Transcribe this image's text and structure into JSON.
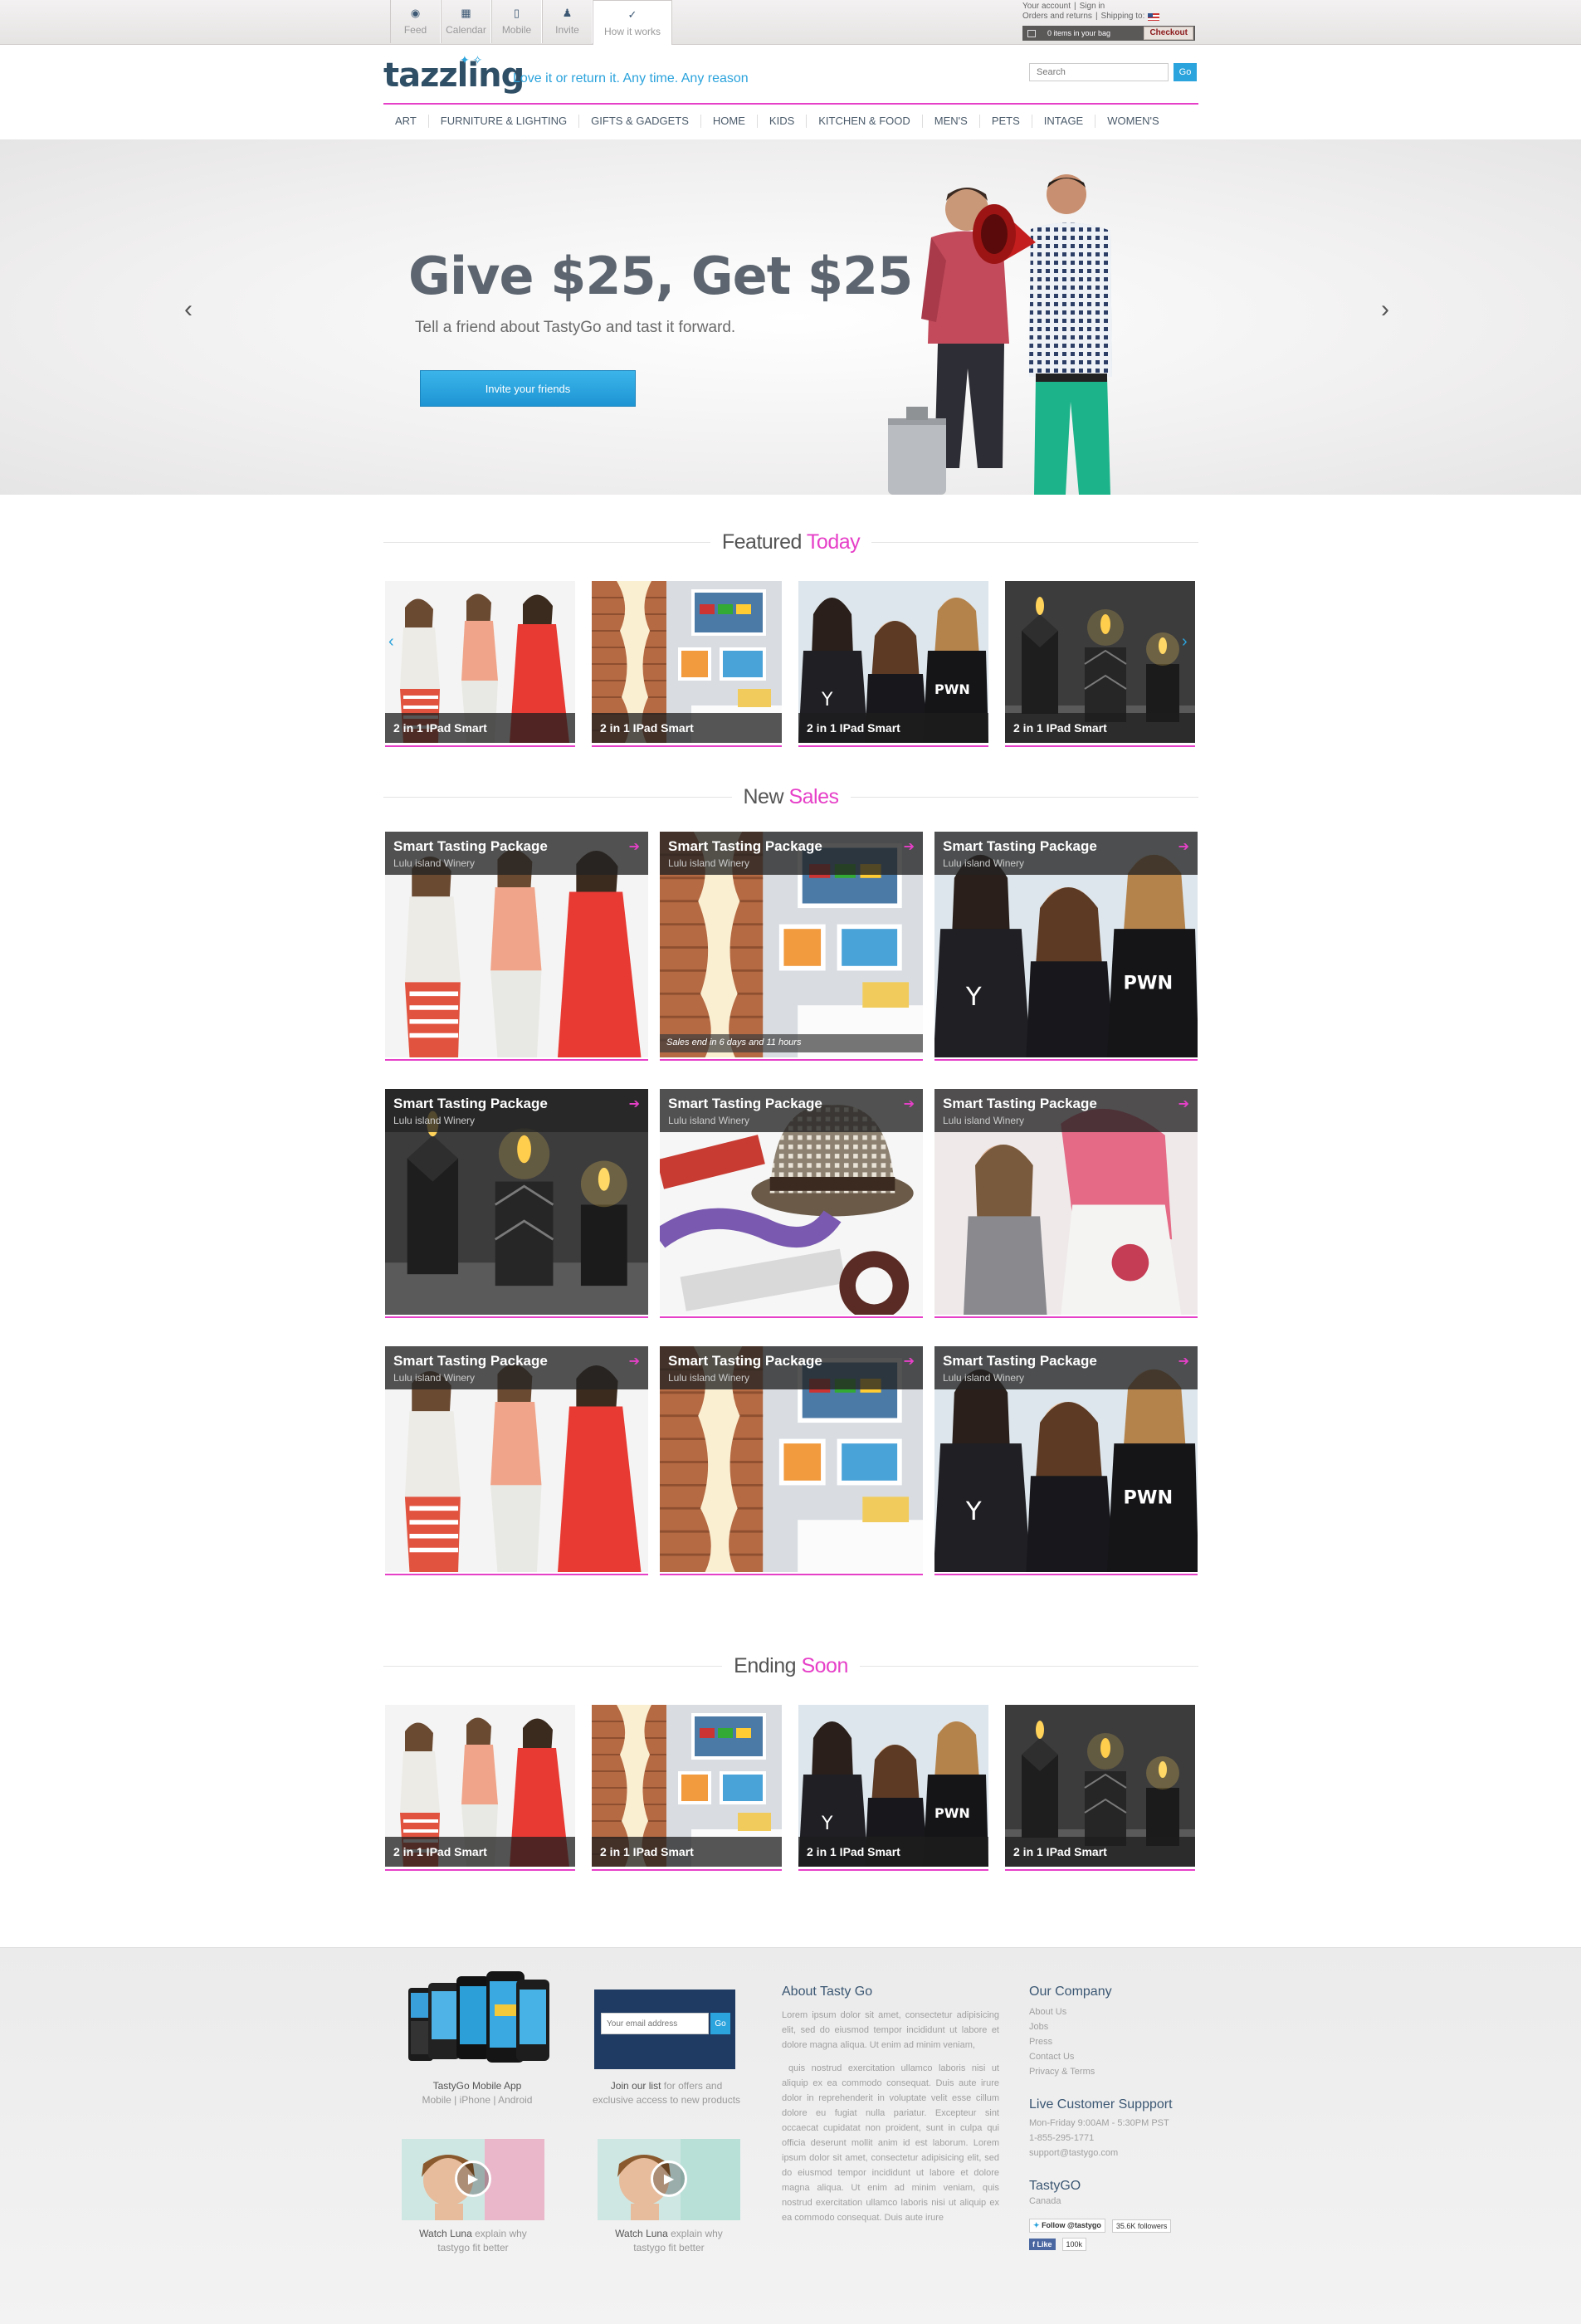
{
  "util_tabs": [
    {
      "label": "Feed",
      "icon": "rss-icon",
      "glyph": "◉"
    },
    {
      "label": "Calendar",
      "icon": "calendar-icon",
      "glyph": "▦"
    },
    {
      "label": "Mobile",
      "icon": "mobile-icon",
      "glyph": "▯"
    },
    {
      "label": "Invite",
      "icon": "invite-icon",
      "glyph": "♟"
    },
    {
      "label": "How it works",
      "icon": "check-icon",
      "glyph": "✓"
    }
  ],
  "account": {
    "your_account": "Your account",
    "sign_in": "Sign in",
    "orders": "Orders and returns",
    "shipping": "Shipping to:",
    "bag": "0 items in your bag",
    "checkout": "Checkout"
  },
  "header": {
    "logo": "tazzling",
    "tagline": "Love it or return it. Any time. Any reason",
    "search_placeholder": "Search",
    "search_go": "Go"
  },
  "nav": [
    "ART",
    "FURNITURE & LIGHTING",
    "GIFTS & GADGETS",
    "HOME",
    "KIDS",
    "KITCHEN & FOOD",
    "MEN'S",
    "PETS",
    "INTAGE",
    "WOMEN'S"
  ],
  "hero": {
    "title": "Give $25, Get $25",
    "subtitle": "Tell a friend about TastyGo and tast it forward.",
    "cta": "Invite your friends",
    "prev": "‹",
    "next": "›"
  },
  "sections": {
    "featured": {
      "a": "Featured",
      "b": "Today"
    },
    "new_sales": {
      "a": "New",
      "b": "Sales"
    },
    "ending": {
      "a": "Ending",
      "b": "Soon"
    }
  },
  "featured_cards": [
    {
      "caption": "2 in 1 IPad Smart",
      "theme": "fashion"
    },
    {
      "caption": "2 in 1 IPad Smart",
      "theme": "interior"
    },
    {
      "caption": "2 in 1 IPad Smart",
      "theme": "teens"
    },
    {
      "caption": "2 in 1 IPad Smart",
      "theme": "candles"
    }
  ],
  "sale_cards": [
    {
      "name": "Smart Tasting Package",
      "vendor": "Lulu island Winery",
      "theme": "fashion",
      "ends": ""
    },
    {
      "name": "Smart Tasting Package",
      "vendor": "Lulu island Winery",
      "theme": "interior",
      "ends": "Sales end in 6 days and 11 hours"
    },
    {
      "name": "Smart Tasting Package",
      "vendor": "Lulu island Winery",
      "theme": "teens",
      "ends": ""
    },
    {
      "name": "Smart Tasting Package",
      "vendor": "Lulu island Winery",
      "theme": "candles",
      "ends": ""
    },
    {
      "name": "Smart Tasting Package",
      "vendor": "Lulu island Winery",
      "theme": "accessories",
      "ends": ""
    },
    {
      "name": "Smart Tasting Package",
      "vendor": "Lulu island Winery",
      "theme": "pinkhair",
      "ends": ""
    },
    {
      "name": "Smart Tasting Package",
      "vendor": "Lulu island Winery",
      "theme": "fashion",
      "ends": ""
    },
    {
      "name": "Smart Tasting Package",
      "vendor": "Lulu island Winery",
      "theme": "interior",
      "ends": ""
    },
    {
      "name": "Smart Tasting Package",
      "vendor": "Lulu island Winery",
      "theme": "teens",
      "ends": ""
    }
  ],
  "ending_cards": [
    {
      "caption": "2 in 1 IPad Smart",
      "theme": "fashion"
    },
    {
      "caption": "2 in 1 IPad Smart",
      "theme": "interior"
    },
    {
      "caption": "2 in 1 IPad Smart",
      "theme": "teens"
    },
    {
      "caption": "2 in 1 IPad Smart",
      "theme": "candles"
    }
  ],
  "footer": {
    "app_title": "TastyGo Mobile App",
    "app_platforms": "Mobile | iPhone | Android",
    "news_placeholder": "Your email address",
    "news_go": "Go",
    "news_title": "Join our list",
    "news_desc": "for offers and",
    "news_desc2": "exclusive access to new products",
    "video1_a": "Watch Luna",
    "video1_b": "explain why",
    "video1_c": "tastygo fit better",
    "video2_a": "Watch Luna",
    "video2_b": "explain why",
    "video2_c": "tastygo fit better",
    "about_title": "About Tasty Go",
    "about_p1": "Lorem ipsum dolor sit amet, consectetur adipisicing elit, sed do eiusmod tempor incididunt ut labore et dolore magna aliqua. Ut enim ad minim veniam,",
    "about_p2": "quis nostrud exercitation ullamco laboris nisi ut aliquip ex ea commodo consequat. Duis aute irure dolor in reprehenderit in voluptate velit esse cillum dolore eu fugiat nulla pariatur. Excepteur sint occaecat cupidatat non proident, sunt in culpa qui officia deserunt mollit anim id est laborum. Lorem ipsum dolor sit amet, consectetur adipisicing elit, sed do eiusmod tempor incididunt ut labore et dolore magna aliqua. Ut enim ad minim veniam, quis nostrud exercitation ullamco laboris nisi ut aliquip ex ea commodo consequat. Duis aute irure",
    "company_title": "Our Company",
    "company_links": [
      "About Us",
      "Jobs",
      "Press",
      "Contact Us",
      "Privacy & Terms"
    ],
    "support_title": "Live Customer Suppport",
    "support_hours": "Mon-Friday 9:00AM - 5:30PM PST",
    "support_phone": "1-855-295-1771",
    "support_email": "support@tastygo.com",
    "brand_title": "TastyGO",
    "brand_country": "Canada",
    "twitter": "Follow @tastygo",
    "twitter_count": "35.6K followers",
    "fb": "Like",
    "fb_count": "100k"
  },
  "colors": {
    "accent": "#e640c8",
    "blue": "#2ba3dc",
    "navy": "#2f4f66"
  }
}
